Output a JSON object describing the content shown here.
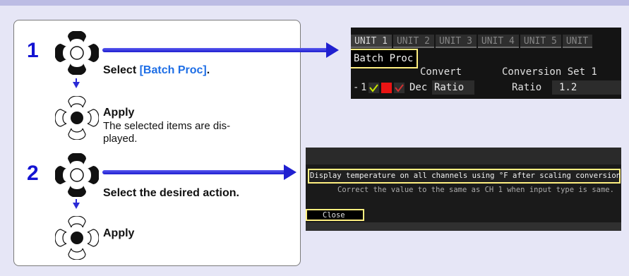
{
  "steps": [
    {
      "number": "1",
      "action_prefix": "Select ",
      "action_highlight": "[Batch Proc]",
      "action_suffix": ".",
      "apply_label": "Apply",
      "apply_desc_line1": "The selected items are dis-",
      "apply_desc_line2": "played."
    },
    {
      "number": "2",
      "action": "Select the desired action.",
      "apply_label": "Apply"
    }
  ],
  "screen1": {
    "tabs": [
      "UNIT 1",
      "UNIT 2",
      "UNIT 3",
      "UNIT 4",
      "UNIT 5",
      "UNIT"
    ],
    "batch_button": "Batch Proc",
    "convert_header": "Convert",
    "conversion_set_header": "Conversion Set 1",
    "row_channel": "1",
    "dec_label": "Dec",
    "ratio_button": "Ratio",
    "ratio_label": "Ratio",
    "ratio_value": "1.2"
  },
  "screen2": {
    "message": "Display temperature on all channels using °F after scaling conversion",
    "submessage": "Correct the value to the same as CH 1 when input type is same.",
    "close_button": "Close"
  },
  "colors": {
    "step_number": "#1414d2",
    "highlight_text": "#1e6ee6",
    "arrow": "#2020d0",
    "screen_highlight": "#ffef80"
  },
  "icons": {
    "dial_highlighted": "rotary-dial-icon",
    "dial_enter": "enter-key-icon",
    "arrow_down": "arrow-down-icon",
    "arrow_right": "arrow-right-icon"
  }
}
